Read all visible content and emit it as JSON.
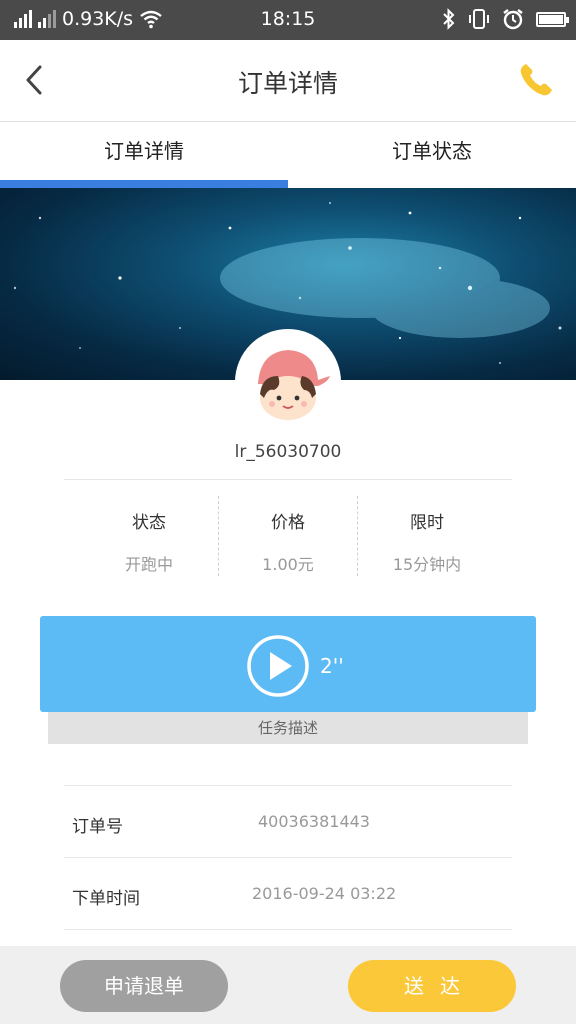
{
  "status_bar": {
    "network_speed": "0.93K/s",
    "time": "18:15"
  },
  "nav": {
    "title": "订单详情",
    "back_icon": "chevron-left-icon",
    "phone_icon": "phone-icon"
  },
  "tabs": [
    {
      "label": "订单详情",
      "active": true
    },
    {
      "label": "订单状态",
      "active": false
    }
  ],
  "user": {
    "username": "lr_56030700"
  },
  "stats": [
    {
      "label": "状态",
      "value": "开跑中"
    },
    {
      "label": "价格",
      "value": "1.00元"
    },
    {
      "label": "限时",
      "value": "15分钟内"
    }
  ],
  "voice": {
    "duration": "2''",
    "caption": "任务描述"
  },
  "info": {
    "order_no_label": "订单号",
    "order_no_value": "40036381443",
    "order_time_label": "下单时间",
    "order_time_value": "2016-09-24 03:22"
  },
  "actions": {
    "refund_label": "申请退单",
    "deliver_label": "送达"
  },
  "colors": {
    "accent_blue": "#3a7ee0",
    "voice_blue": "#5cbaf5",
    "deliver_yellow": "#fbc83a",
    "refund_gray": "#a0a0a0"
  }
}
